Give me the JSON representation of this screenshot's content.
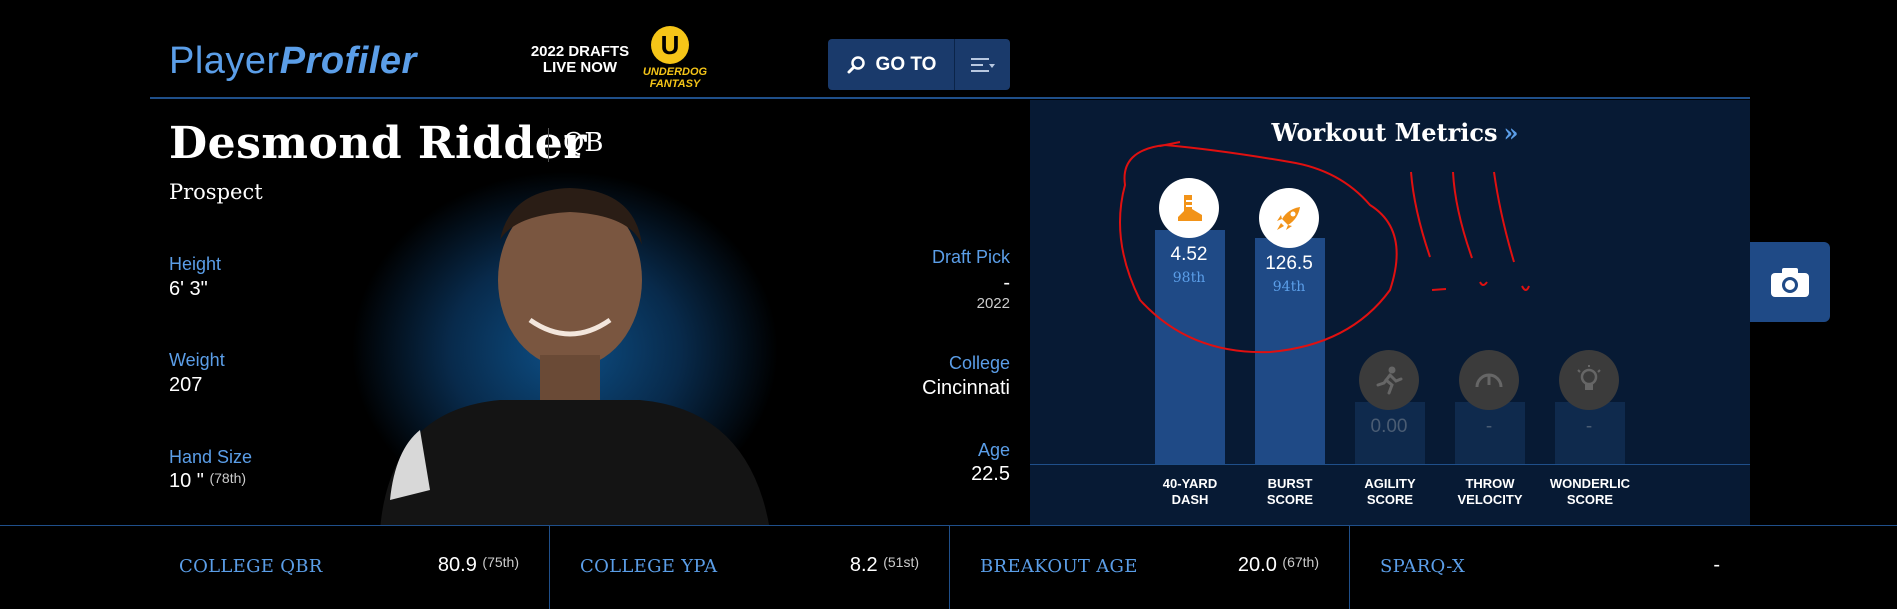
{
  "header": {
    "logo_part1": "Player",
    "logo_part2": "Profiler",
    "promo_line1": "2022 DRAFTS",
    "promo_line2": "LIVE NOW",
    "partner_line1": "UNDERDOG",
    "partner_line2": "FANTASY",
    "goto_label": "GO TO"
  },
  "player": {
    "name": "Desmond Ridder",
    "position": "QB",
    "status": "Prospect",
    "height_label": "Height",
    "height_value": "6' 3\"",
    "weight_label": "Weight",
    "weight_value": "207",
    "hand_label": "Hand Size",
    "hand_value": "10 \"",
    "hand_rank": "(78th)",
    "draft_label": "Draft Pick",
    "draft_value": "-",
    "draft_year": "2022",
    "college_label": "College",
    "college_value": "Cincinnati",
    "age_label": "Age",
    "age_value": "22.5"
  },
  "workout": {
    "title": "Workout Metrics",
    "title_icon": "double-chevron-right-icon",
    "metrics": [
      {
        "label1": "40-YARD",
        "label2": "DASH",
        "value": "4.52",
        "rank": "98th",
        "icon": "shoe-icon"
      },
      {
        "label1": "BURST",
        "label2": "SCORE",
        "value": "126.5",
        "rank": "94th",
        "icon": "rocket-icon"
      },
      {
        "label1": "AGILITY",
        "label2": "SCORE",
        "value": "0.00",
        "rank": "",
        "icon": "runner-icon"
      },
      {
        "label1": "THROW",
        "label2": "VELOCITY",
        "value": "-",
        "rank": "",
        "icon": "gauge-icon"
      },
      {
        "label1": "WONDERLIC",
        "label2": "SCORE",
        "value": "-",
        "rank": "",
        "icon": "lightbulb-icon"
      }
    ]
  },
  "bottom_stats": [
    {
      "label": "COLLEGE QBR",
      "value": "80.9",
      "rank": "(75th)"
    },
    {
      "label": "COLLEGE YPA",
      "value": "8.2",
      "rank": "(51st)"
    },
    {
      "label": "BREAKOUT AGE",
      "value": "20.0",
      "rank": "(67th)"
    },
    {
      "label": "SPARQ-X",
      "value": "-",
      "rank": ""
    }
  ],
  "colors": {
    "accent": "#5b9ee8",
    "panel": "#071a34",
    "bar": "#1f4a86",
    "annotation": "#e01010"
  }
}
